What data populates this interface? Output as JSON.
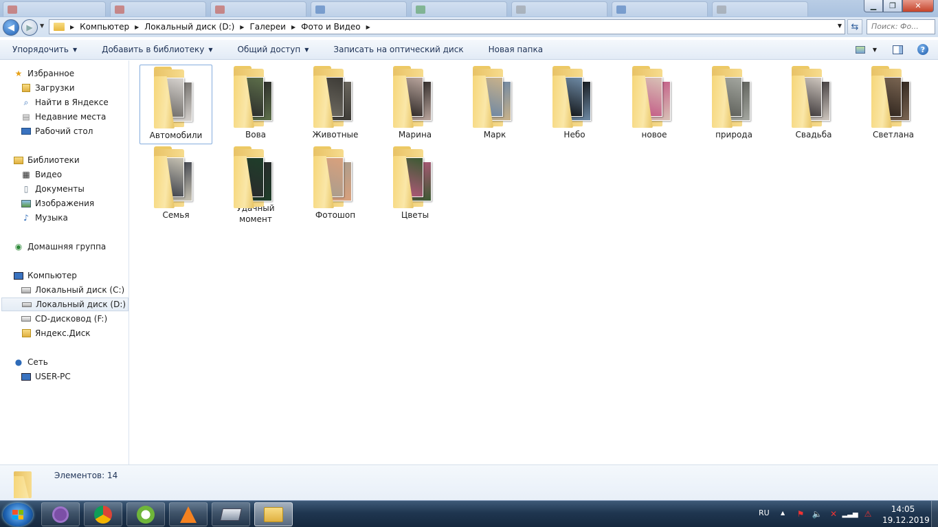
{
  "address": {
    "crumbs": [
      "Компьютер",
      "Локальный диск (D:)",
      "Галереи",
      "Фото и Видео"
    ],
    "search_placeholder": "Поиск: Фо..."
  },
  "toolbar": {
    "organize": "Упорядочить",
    "add_library": "Добавить в библиотеку",
    "share": "Общий доступ",
    "burn": "Записать на оптический диск",
    "new_folder": "Новая папка"
  },
  "nav": {
    "favorites": "Избранное",
    "fav_items": [
      "Загрузки",
      "Найти в Яндексе",
      "Недавние места",
      "Рабочий стол"
    ],
    "libraries": "Библиотеки",
    "lib_items": [
      "Видео",
      "Документы",
      "Изображения",
      "Музыка"
    ],
    "homegroup": "Домашняя группа",
    "computer": "Компьютер",
    "comp_items": [
      "Локальный диск (C:)",
      "Локальный диск (D:)",
      "CD-дисковод (F:)",
      "Яндекс.Диск"
    ],
    "network": "Сеть",
    "net_items": [
      "USER-PC"
    ]
  },
  "folders": [
    {
      "name": "Автомобили",
      "c1": "#d7d3cf",
      "c2": "#6d6a66"
    },
    {
      "name": "Вова",
      "c1": "#5d6f4a",
      "c2": "#2b2b2b"
    },
    {
      "name": "Животные",
      "c1": "#3d3b36",
      "c2": "#6f6b62"
    },
    {
      "name": "Марина",
      "c1": "#b9a59d",
      "c2": "#2a2523"
    },
    {
      "name": "Марк",
      "c1": "#c9b28a",
      "c2": "#6b86a5"
    },
    {
      "name": "Небо",
      "c1": "#6e8aa5",
      "c2": "#101214"
    },
    {
      "name": "новое",
      "c1": "#d8c2b6",
      "c2": "#c35a86"
    },
    {
      "name": "природа",
      "c1": "#a4a7a0",
      "c2": "#5c5e58"
    },
    {
      "name": "Свадьба",
      "c1": "#cfc7bf",
      "c2": "#3a3537"
    },
    {
      "name": "Светлана",
      "c1": "#7a6552",
      "c2": "#2e241d"
    },
    {
      "name": "Семья",
      "c1": "#c7c2b3",
      "c2": "#3b3f49"
    },
    {
      "name": "Удачный момент",
      "c1": "#1f3e2a",
      "c2": "#2a2a2c"
    },
    {
      "name": "Фотошоп",
      "c1": "#d9a07c",
      "c2": "#a89d8e"
    },
    {
      "name": "Цветы",
      "c1": "#3b5a32",
      "c2": "#b2587a"
    }
  ],
  "details": {
    "count": "Элементов: 14"
  },
  "tray": {
    "lang": "RU",
    "time": "14:05",
    "date": "19.12.2019"
  },
  "colors": {
    "accent": "#1f5fb3",
    "selection_border": "#84acdd",
    "folder": "#f6d679"
  }
}
